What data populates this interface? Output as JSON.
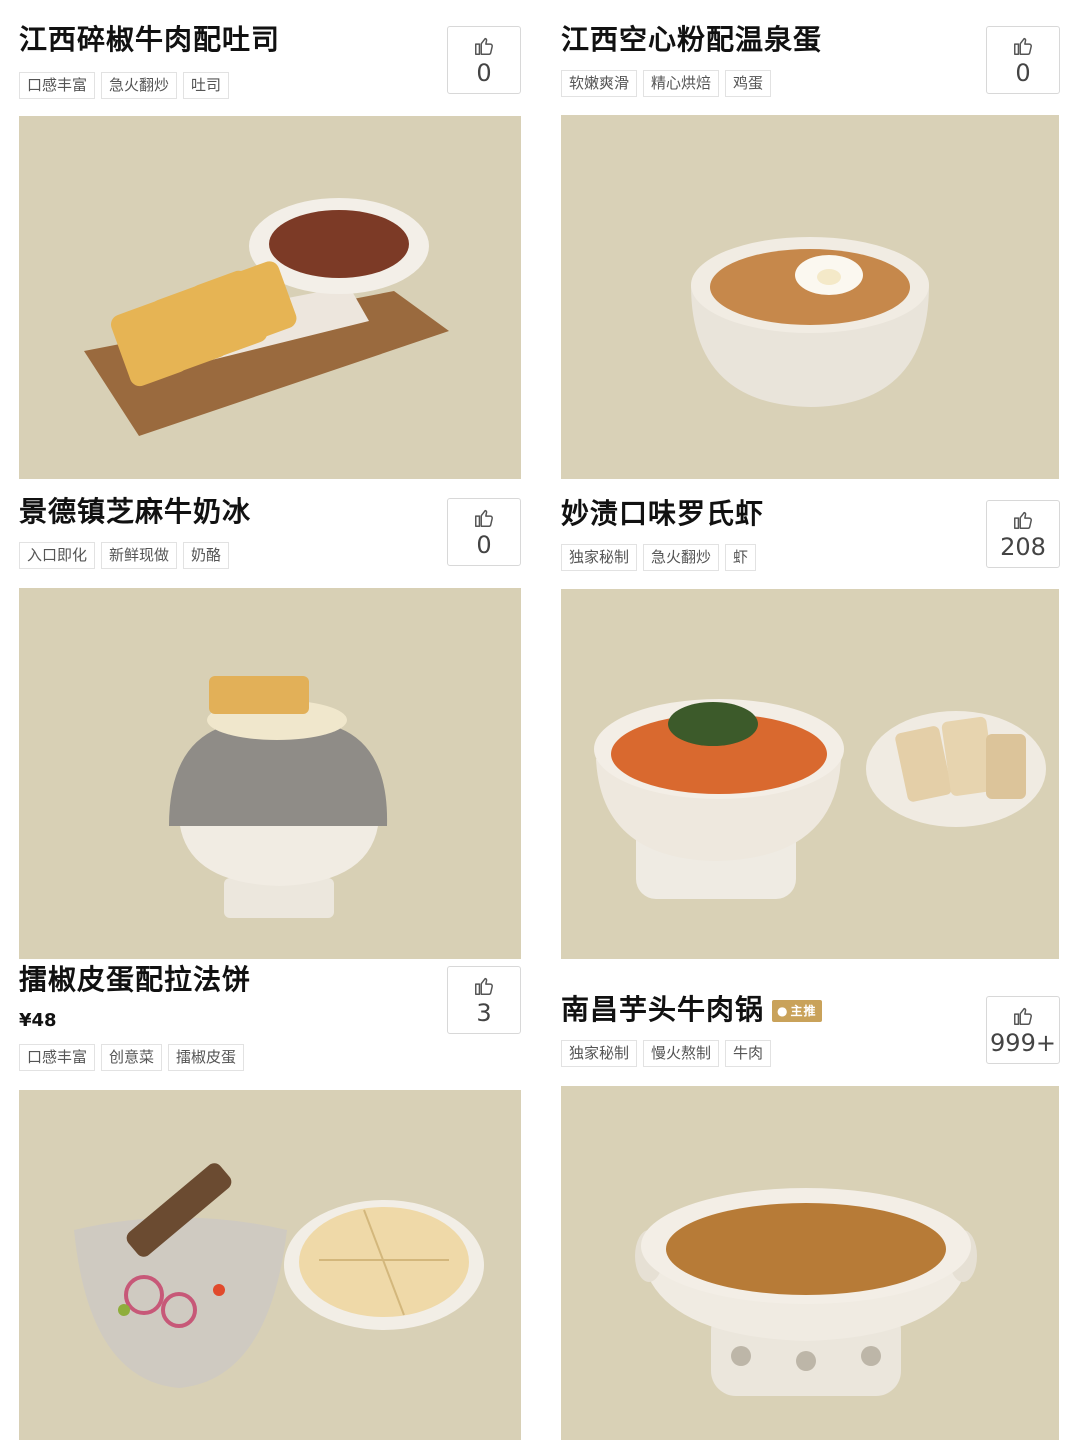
{
  "dishes": [
    {
      "title": "江西碎椒牛肉配吐司",
      "tags": [
        "口感丰富",
        "急火翻炒",
        "吐司"
      ],
      "likes": "0"
    },
    {
      "title": "江西空心粉配温泉蛋",
      "tags": [
        "软嫩爽滑",
        "精心烘焙",
        "鸡蛋"
      ],
      "likes": "0"
    },
    {
      "title": "景德镇芝麻牛奶冰",
      "tags": [
        "入口即化",
        "新鲜现做",
        "奶酪"
      ],
      "likes": "0"
    },
    {
      "title": "妙渍口味罗氏虾",
      "tags": [
        "独家秘制",
        "急火翻炒",
        "虾"
      ],
      "likes": "208"
    },
    {
      "title": "擂椒皮蛋配拉法饼",
      "price": "¥48",
      "tags": [
        "口感丰富",
        "创意菜",
        "擂椒皮蛋"
      ],
      "likes": "3"
    },
    {
      "title": "南昌芋头牛肉锅",
      "badge": "主推",
      "tags": [
        "独家秘制",
        "慢火熬制",
        "牛肉"
      ],
      "likes": "999+"
    }
  ],
  "icons": {
    "like": "thumbs-up-icon",
    "badge": "fire-icon"
  },
  "colors": {
    "photo_bg": "#d7cfb4",
    "badge_bg": "#c9a25a"
  }
}
